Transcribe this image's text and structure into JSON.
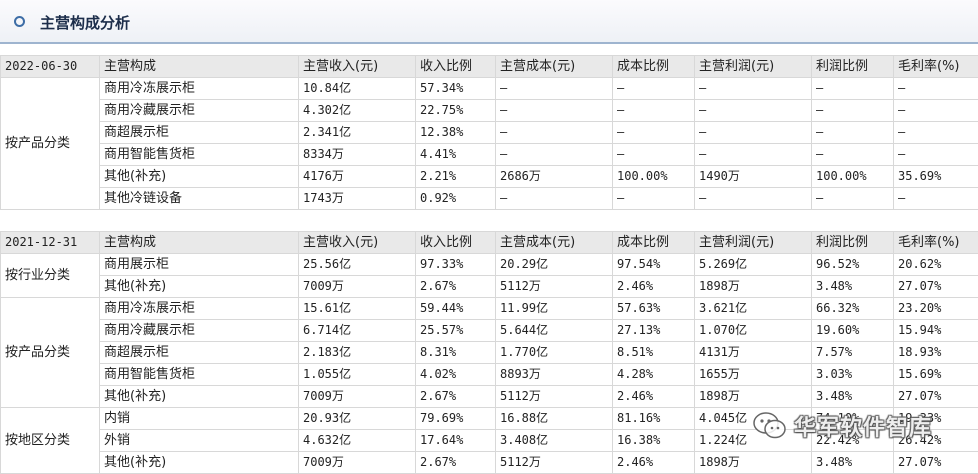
{
  "header": {
    "title": "主营构成分析"
  },
  "columns": [
    "主营构成",
    "主营收入(元)",
    "收入比例",
    "主营成本(元)",
    "成本比例",
    "主营利润(元)",
    "利润比例",
    "毛利率(%)"
  ],
  "sections": [
    {
      "date": "2022-06-30",
      "groups": [
        {
          "category": "按产品分类",
          "rows": [
            [
              "商用冷冻展示柜",
              "10.84亿",
              "57.34%",
              "—",
              "—",
              "—",
              "—",
              "—"
            ],
            [
              "商用冷藏展示柜",
              "4.302亿",
              "22.75%",
              "—",
              "—",
              "—",
              "—",
              "—"
            ],
            [
              "商超展示柜",
              "2.341亿",
              "12.38%",
              "—",
              "—",
              "—",
              "—",
              "—"
            ],
            [
              "商用智能售货柜",
              "8334万",
              "4.41%",
              "—",
              "—",
              "—",
              "—",
              "—"
            ],
            [
              "其他(补充)",
              "4176万",
              "2.21%",
              "2686万",
              "100.00%",
              "1490万",
              "100.00%",
              "35.69%"
            ],
            [
              "其他冷链设备",
              "1743万",
              "0.92%",
              "—",
              "—",
              "—",
              "—",
              "—"
            ]
          ]
        }
      ]
    },
    {
      "date": "2021-12-31",
      "groups": [
        {
          "category": "按行业分类",
          "rows": [
            [
              "商用展示柜",
              "25.56亿",
              "97.33%",
              "20.29亿",
              "97.54%",
              "5.269亿",
              "96.52%",
              "20.62%"
            ],
            [
              "其他(补充)",
              "7009万",
              "2.67%",
              "5112万",
              "2.46%",
              "1898万",
              "3.48%",
              "27.07%"
            ]
          ]
        },
        {
          "category": "按产品分类",
          "rows": [
            [
              "商用冷冻展示柜",
              "15.61亿",
              "59.44%",
              "11.99亿",
              "57.63%",
              "3.621亿",
              "66.32%",
              "23.20%"
            ],
            [
              "商用冷藏展示柜",
              "6.714亿",
              "25.57%",
              "5.644亿",
              "27.13%",
              "1.070亿",
              "19.60%",
              "15.94%"
            ],
            [
              "商超展示柜",
              "2.183亿",
              "8.31%",
              "1.770亿",
              "8.51%",
              "4131万",
              "7.57%",
              "18.93%"
            ],
            [
              "商用智能售货柜",
              "1.055亿",
              "4.02%",
              "8893万",
              "4.28%",
              "1655万",
              "3.03%",
              "15.69%"
            ],
            [
              "其他(补充)",
              "7009万",
              "2.67%",
              "5112万",
              "2.46%",
              "1898万",
              "3.48%",
              "27.07%"
            ]
          ]
        },
        {
          "category": "按地区分类",
          "rows": [
            [
              "内销",
              "20.93亿",
              "79.69%",
              "16.88亿",
              "81.16%",
              "4.045亿",
              "74.10%",
              "19.33%"
            ],
            [
              "外销",
              "4.632亿",
              "17.64%",
              "3.408亿",
              "16.38%",
              "1.224亿",
              "22.42%",
              "26.42%"
            ],
            [
              "其他(补充)",
              "7009万",
              "2.67%",
              "5112万",
              "2.46%",
              "1898万",
              "3.48%",
              "27.07%"
            ]
          ]
        }
      ]
    }
  ],
  "watermark": {
    "text": "华军软件智库",
    "icon": "wechat-icon"
  }
}
